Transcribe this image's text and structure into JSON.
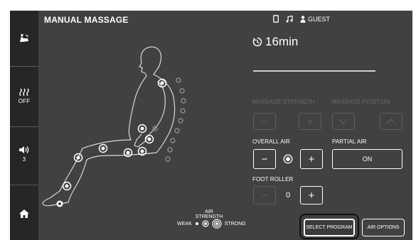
{
  "header": {
    "title": "MANUAL MASSAGE",
    "user": "GUEST",
    "icons": [
      "phone-icon",
      "music-icon",
      "user-icon"
    ]
  },
  "timer": {
    "value": "16min"
  },
  "progress": {
    "fraction": 0.0
  },
  "sidebar": {
    "items": [
      {
        "name": "recline",
        "icon": "recline-chair-icon",
        "label": ""
      },
      {
        "name": "heat",
        "icon": "heat-icon",
        "label": "OFF"
      },
      {
        "name": "volume",
        "icon": "speaker-icon",
        "label": "3"
      },
      {
        "name": "home",
        "icon": "home-icon",
        "label": ""
      }
    ]
  },
  "controls": {
    "massage_strength": {
      "label": "MASSAGE STRENGTH",
      "enabled": false
    },
    "massage_position": {
      "label": "MASSAGE POSITION",
      "enabled": false
    },
    "overall_air": {
      "label": "OVERALL AIR"
    },
    "partial_air": {
      "label": "PARTIAL AIR",
      "button": "ON"
    },
    "foot_roller": {
      "label": "FOOT ROLLER",
      "value": "0"
    }
  },
  "air_strength": {
    "title": "AIR STRENGTH",
    "weak": "WEAK",
    "strong": "STRONG"
  },
  "bottom": {
    "select_program": "SELECT PROGRAM",
    "air_options": "AIR OPTIONS"
  },
  "colors": {
    "background": "#414141",
    "sidebar": "#262626",
    "accent": "#ffffff",
    "disabled": "#5e5e5e"
  }
}
